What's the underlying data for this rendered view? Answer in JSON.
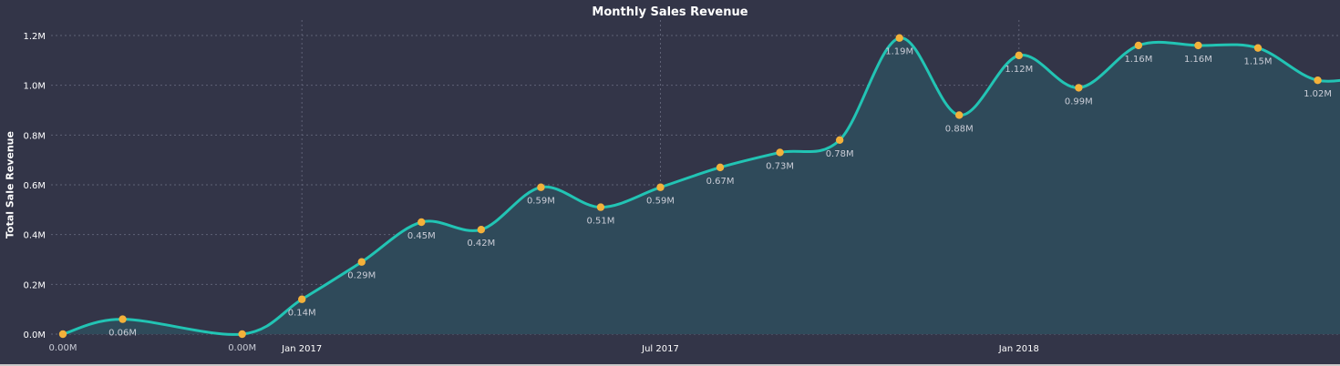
{
  "chart_data": {
    "type": "area",
    "title": "Monthly Sales Revenue",
    "xlabel": "",
    "ylabel": "Total Sale Revenue",
    "ylim": [
      0,
      1.2
    ],
    "yticks": [
      "0.0M",
      "0.2M",
      "0.4M",
      "0.6M",
      "0.8M",
      "1.0M",
      "1.2M"
    ],
    "xticks": [
      "Jan 2017",
      "Jul 2017",
      "Jan 2018"
    ],
    "x": [
      "2016-09",
      "2016-10",
      "2016-12",
      "2017-01",
      "2017-02",
      "2017-03",
      "2017-04",
      "2017-05",
      "2017-06",
      "2017-07",
      "2017-08",
      "2017-09",
      "2017-10",
      "2017-11",
      "2017-12",
      "2018-01",
      "2018-02",
      "2018-03",
      "2018-04",
      "2018-05",
      "2018-06",
      "2018-07"
    ],
    "values": [
      0.0,
      0.06,
      0.0,
      0.14,
      0.29,
      0.45,
      0.42,
      0.59,
      0.51,
      0.59,
      0.67,
      0.73,
      0.78,
      1.19,
      0.88,
      1.12,
      0.99,
      1.16,
      1.16,
      1.15,
      1.02,
      1.05
    ],
    "labels": [
      "0.00M",
      "0.06M",
      "0.00M",
      "0.14M",
      "0.29M",
      "0.45M",
      "0.42M",
      "0.59M",
      "0.51M",
      "0.59M",
      "0.67M",
      "0.73M",
      "0.78M",
      "1.19M",
      "0.88M",
      "1.12M",
      "0.99M",
      "1.16M",
      "1.16M",
      "1.15M",
      "1.02M",
      ""
    ],
    "grid": true,
    "legend": "none"
  },
  "colors": {
    "background": "#333548",
    "line": "#22c4b4",
    "area": "#2f4a5a",
    "marker": "#f3b13a",
    "grid": "#5f6276"
  }
}
